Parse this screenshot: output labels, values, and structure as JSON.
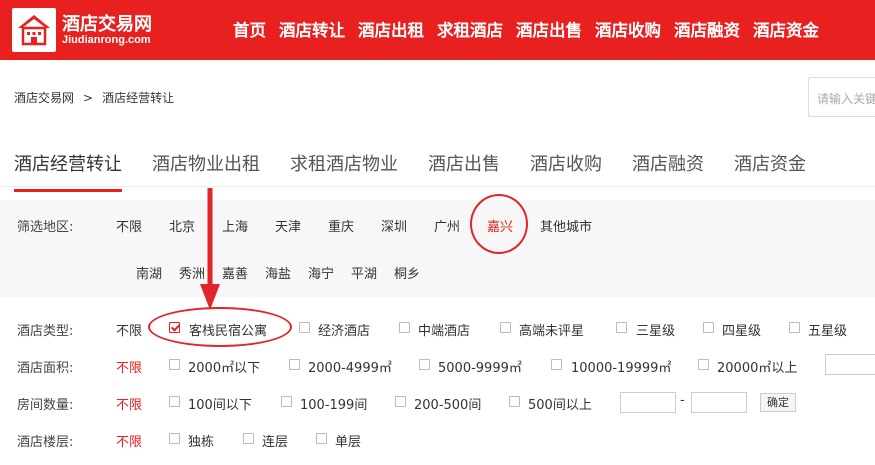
{
  "header": {
    "logo_name": "酒店交易网",
    "logo_url": "Jiudianrong.com",
    "nav": [
      "首页",
      "酒店转让",
      "酒店出租",
      "求租酒店",
      "酒店出售",
      "酒店收购",
      "酒店融资",
      "酒店资金"
    ]
  },
  "breadcrumb": {
    "home": "酒店交易网",
    "sep": ">",
    "current": "酒店经营转让"
  },
  "search": {
    "placeholder": "请输入关键"
  },
  "tabs": [
    "酒店经营转让",
    "酒店物业出租",
    "求租酒店物业",
    "酒店出售",
    "酒店收购",
    "酒店融资",
    "酒店资金"
  ],
  "active_tab": "酒店经营转让",
  "filters": {
    "region": {
      "label": "筛选地区:",
      "options": [
        "不限",
        "北京",
        "上海",
        "天津",
        "重庆",
        "深圳",
        "广州",
        "嘉兴",
        "其他城市"
      ],
      "selected": "嘉兴",
      "sub_options": [
        "南湖",
        "秀洲",
        "嘉善",
        "海盐",
        "海宁",
        "平湖",
        "桐乡"
      ]
    },
    "hotel_type": {
      "label": "酒店类型:",
      "unlimited": "不限",
      "options": [
        "客栈民宿公寓",
        "经济酒店",
        "中端酒店",
        "高端未评星",
        "三星级",
        "四星级",
        "五星级"
      ],
      "checked": "客栈民宿公寓"
    },
    "area": {
      "label": "酒店面积:",
      "unlimited": "不限",
      "options": [
        "2000㎡以下",
        "2000-4999㎡",
        "5000-9999㎡",
        "10000-19999㎡",
        "20000㎡以上"
      ]
    },
    "rooms": {
      "label": "房间数量:",
      "unlimited": "不限",
      "options": [
        "100间以下",
        "100-199间",
        "200-500间",
        "500间以上"
      ],
      "range_sep": "-",
      "confirm": "确定"
    },
    "floors": {
      "label": "酒店楼层:",
      "unlimited": "不限",
      "options": [
        "独栋",
        "连层",
        "单层"
      ]
    }
  },
  "colors": {
    "brand": "#e8201f",
    "annotation": "#e0262a"
  }
}
